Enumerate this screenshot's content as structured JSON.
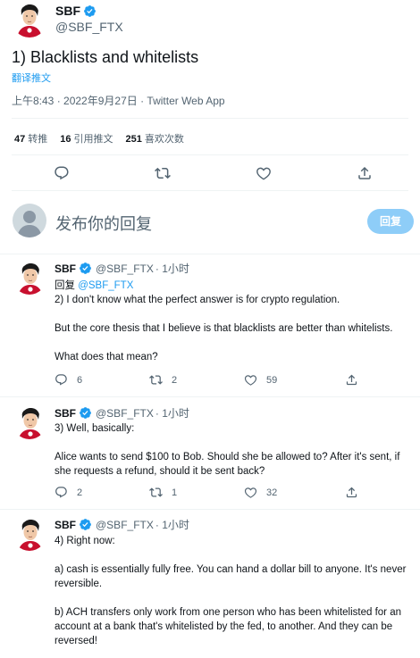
{
  "main_tweet": {
    "author_name": "SBF",
    "author_handle": "@SBF_FTX",
    "text": "1) Blacklists and whitelists",
    "translate_label": "翻译推文",
    "meta": "上午8:43 · 2022年9月27日 · Twitter Web App",
    "stats": {
      "retweets_count": "47",
      "retweets_label": "转推",
      "quotes_count": "16",
      "quotes_label": "引用推文",
      "likes_count": "251",
      "likes_label": "喜欢次数"
    }
  },
  "reply_compose": {
    "placeholder": "发布你的回复",
    "button_label": "回复"
  },
  "replies": [
    {
      "author_name": "SBF",
      "author_handle": "@SBF_FTX",
      "time": "· 1小时",
      "replying_prefix": "回复",
      "replying_to": "@SBF_FTX",
      "paragraphs": [
        "2) I don't know what the perfect answer is for crypto regulation.",
        "But the core thesis that I believe is that blacklists are better than whitelists.",
        "What does that mean?"
      ],
      "reply_count": "6",
      "retweet_count": "2",
      "like_count": "59"
    },
    {
      "author_name": "SBF",
      "author_handle": "@SBF_FTX",
      "time": "· 1小时",
      "paragraphs": [
        "3) Well, basically:",
        "Alice wants to send $100 to Bob.  Should she be allowed to?  After it's sent, if she requests a refund, should it be sent back?"
      ],
      "reply_count": "2",
      "retweet_count": "1",
      "like_count": "32"
    },
    {
      "author_name": "SBF",
      "author_handle": "@SBF_FTX",
      "time": "· 1小时",
      "paragraphs": [
        "4) Right now:",
        "a) cash is essentially fully free.  You can hand a dollar bill to anyone.  It's never reversible.",
        "b) ACH transfers only work from one person who has been whitelisted for an account at a bank that's whitelisted by the fed, to another.  And they can be reversed!"
      ]
    }
  ],
  "colors": {
    "accent": "#1d9bf0",
    "verified": "#1d9bf0",
    "reply_button_disabled": "#8ecdf8",
    "secondary_text": "#536471",
    "divider": "#eff3f4"
  },
  "icons": [
    "verified-badge-icon",
    "reply-icon",
    "retweet-icon",
    "like-icon",
    "share-icon"
  ]
}
